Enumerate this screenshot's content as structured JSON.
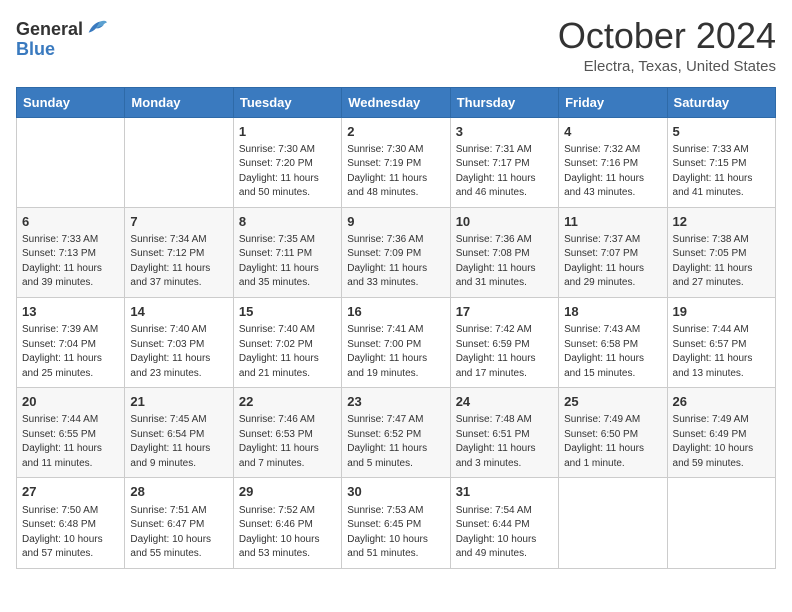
{
  "header": {
    "logo": {
      "line1": "General",
      "line2": "Blue"
    },
    "title": "October 2024",
    "location": "Electra, Texas, United States"
  },
  "weekdays": [
    "Sunday",
    "Monday",
    "Tuesday",
    "Wednesday",
    "Thursday",
    "Friday",
    "Saturday"
  ],
  "weeks": [
    [
      {
        "day": "",
        "info": ""
      },
      {
        "day": "",
        "info": ""
      },
      {
        "day": "1",
        "info": "Sunrise: 7:30 AM\nSunset: 7:20 PM\nDaylight: 11 hours and 50 minutes."
      },
      {
        "day": "2",
        "info": "Sunrise: 7:30 AM\nSunset: 7:19 PM\nDaylight: 11 hours and 48 minutes."
      },
      {
        "day": "3",
        "info": "Sunrise: 7:31 AM\nSunset: 7:17 PM\nDaylight: 11 hours and 46 minutes."
      },
      {
        "day": "4",
        "info": "Sunrise: 7:32 AM\nSunset: 7:16 PM\nDaylight: 11 hours and 43 minutes."
      },
      {
        "day": "5",
        "info": "Sunrise: 7:33 AM\nSunset: 7:15 PM\nDaylight: 11 hours and 41 minutes."
      }
    ],
    [
      {
        "day": "6",
        "info": "Sunrise: 7:33 AM\nSunset: 7:13 PM\nDaylight: 11 hours and 39 minutes."
      },
      {
        "day": "7",
        "info": "Sunrise: 7:34 AM\nSunset: 7:12 PM\nDaylight: 11 hours and 37 minutes."
      },
      {
        "day": "8",
        "info": "Sunrise: 7:35 AM\nSunset: 7:11 PM\nDaylight: 11 hours and 35 minutes."
      },
      {
        "day": "9",
        "info": "Sunrise: 7:36 AM\nSunset: 7:09 PM\nDaylight: 11 hours and 33 minutes."
      },
      {
        "day": "10",
        "info": "Sunrise: 7:36 AM\nSunset: 7:08 PM\nDaylight: 11 hours and 31 minutes."
      },
      {
        "day": "11",
        "info": "Sunrise: 7:37 AM\nSunset: 7:07 PM\nDaylight: 11 hours and 29 minutes."
      },
      {
        "day": "12",
        "info": "Sunrise: 7:38 AM\nSunset: 7:05 PM\nDaylight: 11 hours and 27 minutes."
      }
    ],
    [
      {
        "day": "13",
        "info": "Sunrise: 7:39 AM\nSunset: 7:04 PM\nDaylight: 11 hours and 25 minutes."
      },
      {
        "day": "14",
        "info": "Sunrise: 7:40 AM\nSunset: 7:03 PM\nDaylight: 11 hours and 23 minutes."
      },
      {
        "day": "15",
        "info": "Sunrise: 7:40 AM\nSunset: 7:02 PM\nDaylight: 11 hours and 21 minutes."
      },
      {
        "day": "16",
        "info": "Sunrise: 7:41 AM\nSunset: 7:00 PM\nDaylight: 11 hours and 19 minutes."
      },
      {
        "day": "17",
        "info": "Sunrise: 7:42 AM\nSunset: 6:59 PM\nDaylight: 11 hours and 17 minutes."
      },
      {
        "day": "18",
        "info": "Sunrise: 7:43 AM\nSunset: 6:58 PM\nDaylight: 11 hours and 15 minutes."
      },
      {
        "day": "19",
        "info": "Sunrise: 7:44 AM\nSunset: 6:57 PM\nDaylight: 11 hours and 13 minutes."
      }
    ],
    [
      {
        "day": "20",
        "info": "Sunrise: 7:44 AM\nSunset: 6:55 PM\nDaylight: 11 hours and 11 minutes."
      },
      {
        "day": "21",
        "info": "Sunrise: 7:45 AM\nSunset: 6:54 PM\nDaylight: 11 hours and 9 minutes."
      },
      {
        "day": "22",
        "info": "Sunrise: 7:46 AM\nSunset: 6:53 PM\nDaylight: 11 hours and 7 minutes."
      },
      {
        "day": "23",
        "info": "Sunrise: 7:47 AM\nSunset: 6:52 PM\nDaylight: 11 hours and 5 minutes."
      },
      {
        "day": "24",
        "info": "Sunrise: 7:48 AM\nSunset: 6:51 PM\nDaylight: 11 hours and 3 minutes."
      },
      {
        "day": "25",
        "info": "Sunrise: 7:49 AM\nSunset: 6:50 PM\nDaylight: 11 hours and 1 minute."
      },
      {
        "day": "26",
        "info": "Sunrise: 7:49 AM\nSunset: 6:49 PM\nDaylight: 10 hours and 59 minutes."
      }
    ],
    [
      {
        "day": "27",
        "info": "Sunrise: 7:50 AM\nSunset: 6:48 PM\nDaylight: 10 hours and 57 minutes."
      },
      {
        "day": "28",
        "info": "Sunrise: 7:51 AM\nSunset: 6:47 PM\nDaylight: 10 hours and 55 minutes."
      },
      {
        "day": "29",
        "info": "Sunrise: 7:52 AM\nSunset: 6:46 PM\nDaylight: 10 hours and 53 minutes."
      },
      {
        "day": "30",
        "info": "Sunrise: 7:53 AM\nSunset: 6:45 PM\nDaylight: 10 hours and 51 minutes."
      },
      {
        "day": "31",
        "info": "Sunrise: 7:54 AM\nSunset: 6:44 PM\nDaylight: 10 hours and 49 minutes."
      },
      {
        "day": "",
        "info": ""
      },
      {
        "day": "",
        "info": ""
      }
    ]
  ]
}
